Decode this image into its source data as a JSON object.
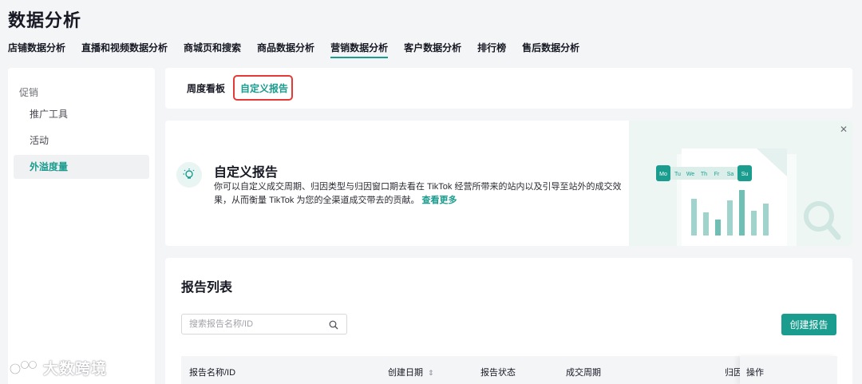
{
  "page": {
    "title": "数据分析"
  },
  "top_nav": {
    "tabs": [
      {
        "label": "店铺数据分析"
      },
      {
        "label": "直播和视频数据分析"
      },
      {
        "label": "商城页和搜索"
      },
      {
        "label": "商品数据分析"
      },
      {
        "label": "营销数据分析",
        "active": true
      },
      {
        "label": "客户数据分析"
      },
      {
        "label": "排行榜"
      },
      {
        "label": "售后数据分析"
      }
    ]
  },
  "sidebar": {
    "group_label": "促销",
    "items": [
      {
        "label": "推广工具"
      },
      {
        "label": "活动"
      },
      {
        "label": "外溢度量",
        "active": true
      }
    ]
  },
  "subtabs": {
    "items": [
      {
        "label": "周度看板"
      },
      {
        "label": "自定义报告",
        "active": true
      }
    ]
  },
  "banner": {
    "title": "自定义报告",
    "description": "你可以自定义成交周期、归因类型与归因窗口期去看在 TikTok 经营所带来的站内以及引导至站外的成交效果，从而衡量 TikTok 为您的全渠道成交带去的贡献。",
    "link": "查看更多",
    "close_icon": "close-icon",
    "illustration": {
      "days": [
        "Mo",
        "Tu",
        "We",
        "Th",
        "Fr",
        "Sa",
        "Su"
      ],
      "accent": "#1a9c8f"
    }
  },
  "report_list": {
    "title": "报告列表",
    "search_placeholder": "搜索报告名称/ID",
    "create_button": "创建报告",
    "columns": [
      {
        "label": "报告名称/ID"
      },
      {
        "label": "创建日期",
        "sortable": true
      },
      {
        "label": "报告状态"
      },
      {
        "label": "成交周期"
      },
      {
        "label": "归因"
      },
      {
        "label": "操作"
      }
    ]
  },
  "watermark": {
    "text": "大数跨境"
  },
  "colors": {
    "accent": "#1a9c8f",
    "highlight": "#e53935",
    "background": "#f4f5f7"
  }
}
